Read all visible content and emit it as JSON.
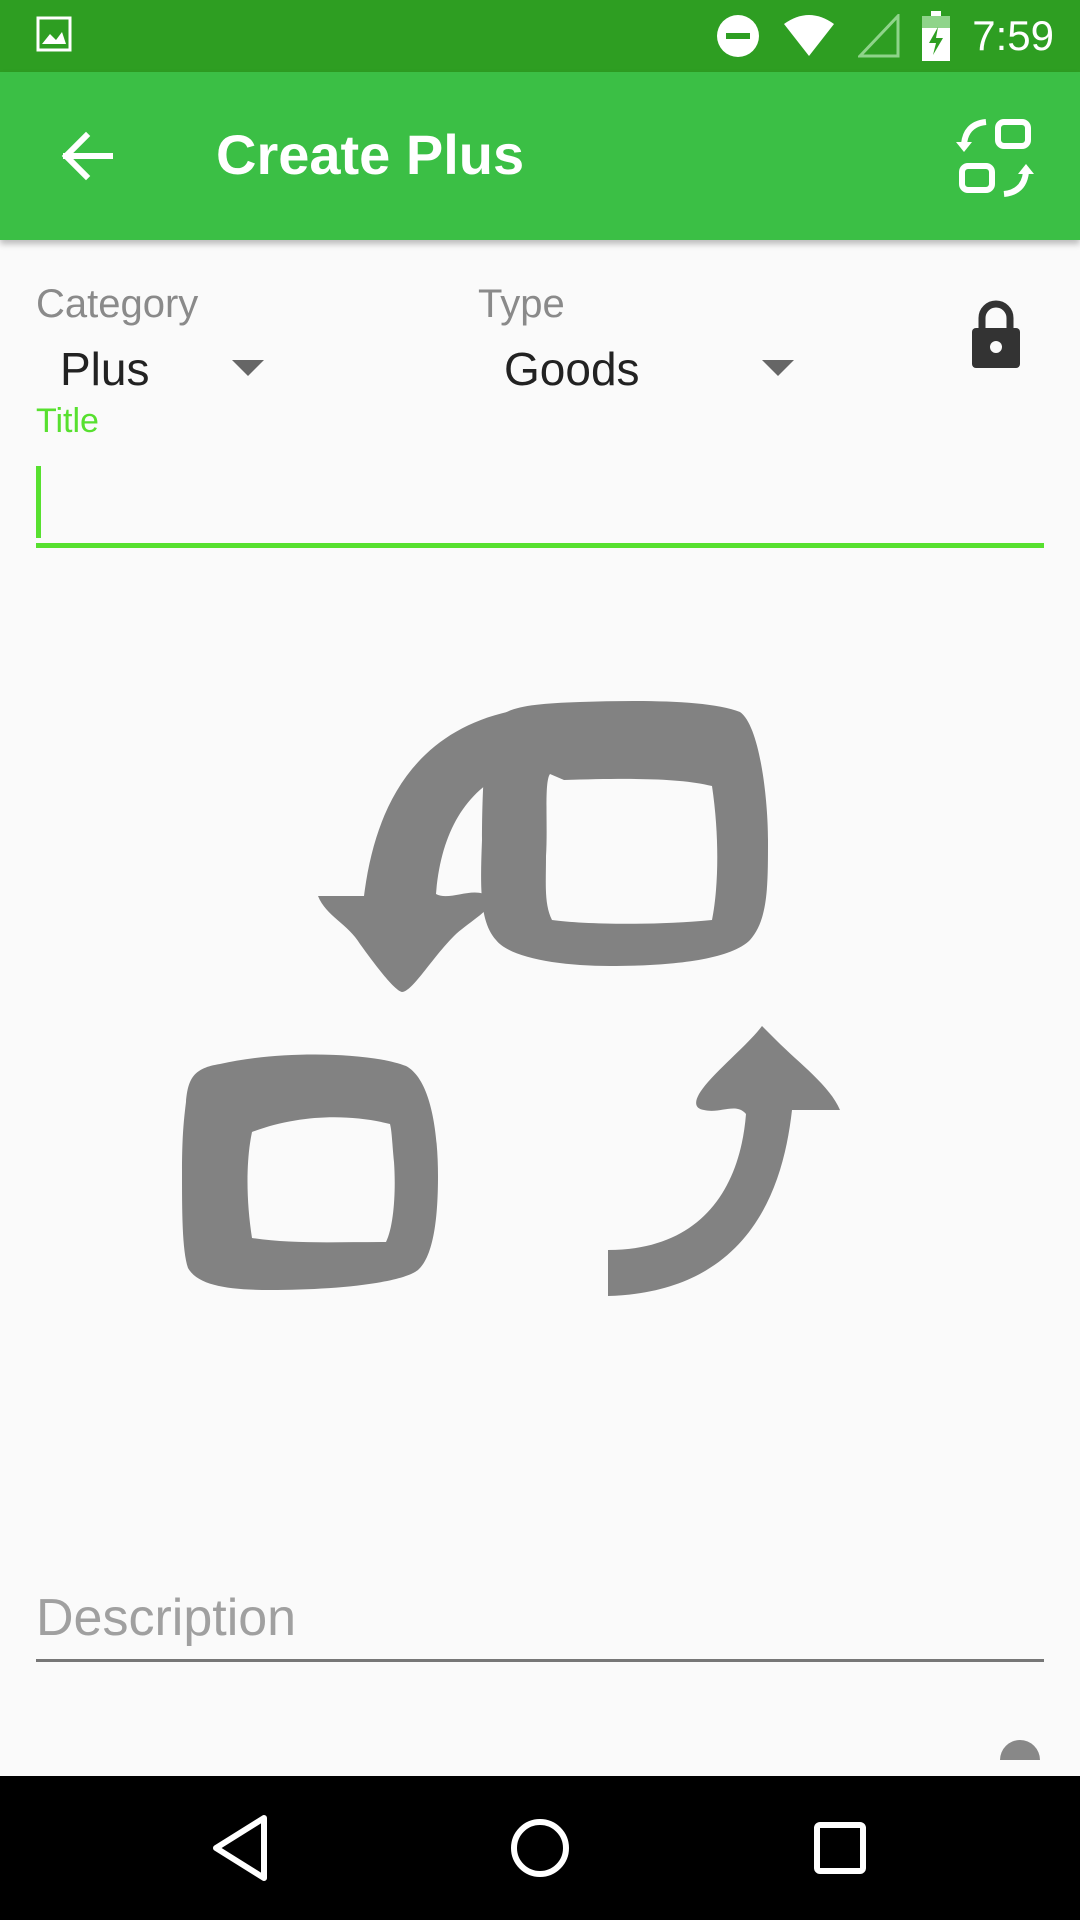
{
  "status_bar": {
    "time": "7:59"
  },
  "app_bar": {
    "title": "Create Plus"
  },
  "form": {
    "category": {
      "label": "Category",
      "value": "Plus"
    },
    "type": {
      "label": "Type",
      "value": "Goods"
    },
    "title": {
      "label": "Title",
      "value": ""
    },
    "description": {
      "placeholder": "Description"
    }
  },
  "colors": {
    "status_bar": "#2e9e22",
    "app_bar": "#3bbf45",
    "accent": "#57e02f"
  },
  "icons": [
    "gallery-icon",
    "dnd-icon",
    "wifi-icon",
    "signal-icon",
    "battery-charging-icon",
    "back-arrow-icon",
    "screen-rotation-icon",
    "lock-icon",
    "nav-back-icon",
    "nav-home-icon",
    "nav-recents-icon"
  ]
}
